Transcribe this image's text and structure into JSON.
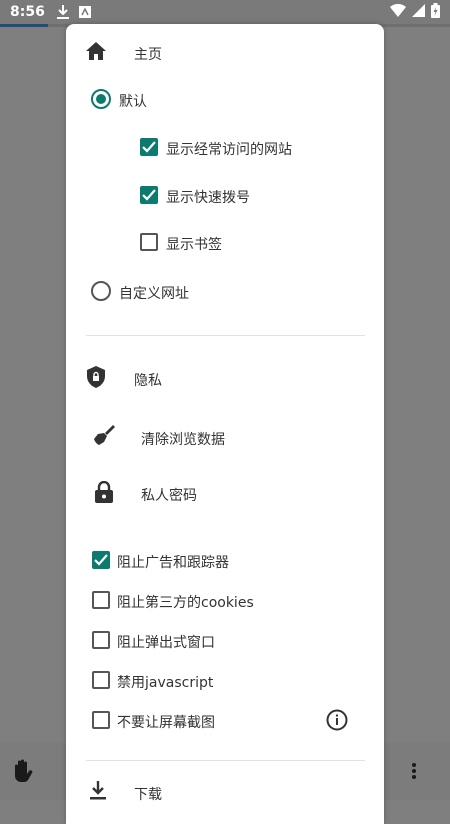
{
  "status_bar": {
    "time": "8:56",
    "left_icons": [
      "download-icon",
      "app-notification-icon"
    ],
    "right_icons": [
      "wifi-icon",
      "signal-icon",
      "battery-icon"
    ]
  },
  "colors": {
    "accent": "#0d7a70",
    "scrim": "#7f7f7f",
    "panel": "#ffffff"
  },
  "homepage": {
    "section_label": "主页",
    "icon": "home-icon",
    "default_option": {
      "label": "默认",
      "selected": true
    },
    "sub_options": [
      {
        "label": "显示经常访问的网站",
        "checked": true
      },
      {
        "label": "显示快速拨号",
        "checked": true
      },
      {
        "label": "显示书签",
        "checked": false
      }
    ],
    "custom_option": {
      "label": "自定义网址",
      "selected": false
    }
  },
  "privacy": {
    "section_label": "隐私",
    "icon": "shield-icon",
    "actions": [
      {
        "label": "清除浏览数据",
        "icon": "broom-icon"
      },
      {
        "label": "私人密码",
        "icon": "lock-icon"
      }
    ],
    "toggles": [
      {
        "label": "阻止广告和跟踪器",
        "checked": true
      },
      {
        "label": "阻止第三方的cookies",
        "checked": false
      },
      {
        "label": "阻止弹出式窗口",
        "checked": false
      },
      {
        "label": "禁用javascript",
        "checked": false
      },
      {
        "label": "不要让屏幕截图",
        "checked": false,
        "info_icon": "info-icon"
      }
    ]
  },
  "downloads": {
    "section_label": "下载",
    "icon": "download-icon"
  },
  "bottom_bar": {
    "left_icon": "hand-icon",
    "right_icon": "more-vert-icon"
  }
}
